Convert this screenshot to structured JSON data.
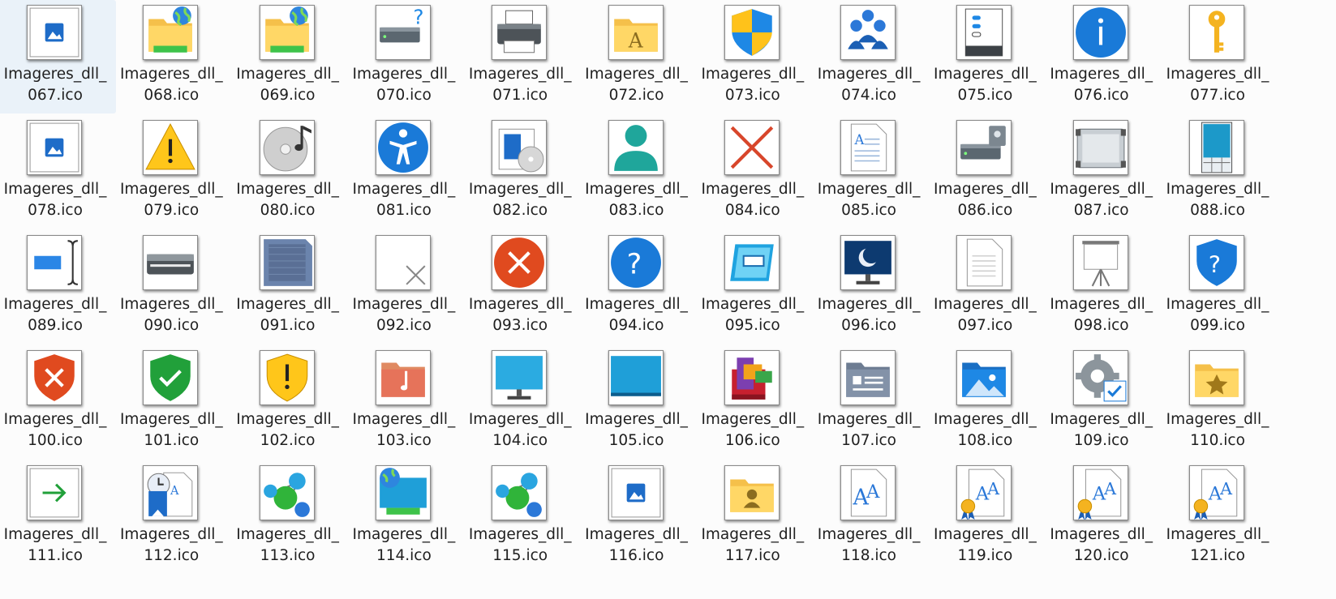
{
  "window": {
    "view": "Large icons"
  },
  "colors": {
    "background": "#fcfcfc",
    "text": "#1f1f1f",
    "thumb_border": "#8a8a8a",
    "accent": "#0078d4"
  },
  "files": [
    {
      "line1": "Imageres_dll_",
      "line2": "067.ico",
      "icon": "picture-frame-icon"
    },
    {
      "line1": "Imageres_dll_",
      "line2": "068.ico",
      "icon": "network-folder-globe-icon"
    },
    {
      "line1": "Imageres_dll_",
      "line2": "069.ico",
      "icon": "network-folder-globe-icon"
    },
    {
      "line1": "Imageres_dll_",
      "line2": "070.ico",
      "icon": "unknown-drive-icon"
    },
    {
      "line1": "Imageres_dll_",
      "line2": "071.ico",
      "icon": "printer-icon"
    },
    {
      "line1": "Imageres_dll_",
      "line2": "072.ico",
      "icon": "fonts-folder-icon"
    },
    {
      "line1": "Imageres_dll_",
      "line2": "073.ico",
      "icon": "uac-shield-icon"
    },
    {
      "line1": "Imageres_dll_",
      "line2": "074.ico",
      "icon": "user-group-icon"
    },
    {
      "line1": "Imageres_dll_",
      "line2": "075.ico",
      "icon": "server-settings-icon"
    },
    {
      "line1": "Imageres_dll_",
      "line2": "076.ico",
      "icon": "info-icon"
    },
    {
      "line1": "Imageres_dll_",
      "line2": "077.ico",
      "icon": "key-icon"
    },
    {
      "line1": "Imageres_dll_",
      "line2": "078.ico",
      "icon": "picture-frame-icon"
    },
    {
      "line1": "Imageres_dll_",
      "line2": "079.ico",
      "icon": "warning-icon"
    },
    {
      "line1": "Imageres_dll_",
      "line2": "080.ico",
      "icon": "music-disc-icon"
    },
    {
      "line1": "Imageres_dll_",
      "line2": "081.ico",
      "icon": "accessibility-icon"
    },
    {
      "line1": "Imageres_dll_",
      "line2": "082.ico",
      "icon": "software-disc-icon"
    },
    {
      "line1": "Imageres_dll_",
      "line2": "083.ico",
      "icon": "user-icon"
    },
    {
      "line1": "Imageres_dll_",
      "line2": "084.ico",
      "icon": "red-x-icon"
    },
    {
      "line1": "Imageres_dll_",
      "line2": "085.ico",
      "icon": "text-document-icon"
    },
    {
      "line1": "Imageres_dll_",
      "line2": "086.ico",
      "icon": "drive-lock-icon"
    },
    {
      "line1": "Imageres_dll_",
      "line2": "087.ico",
      "icon": "hardware-panel-icon"
    },
    {
      "line1": "Imageres_dll_",
      "line2": "088.ico",
      "icon": "phone-device-icon"
    },
    {
      "line1": "Imageres_dll_",
      "line2": "089.ico",
      "icon": "text-cursor-icon"
    },
    {
      "line1": "Imageres_dll_",
      "line2": "090.ico",
      "icon": "scanner-icon"
    },
    {
      "line1": "Imageres_dll_",
      "line2": "091.ico",
      "icon": "memory-card-icon"
    },
    {
      "line1": "Imageres_dll_",
      "line2": "092.ico",
      "icon": "blank-x-icon"
    },
    {
      "line1": "Imageres_dll_",
      "line2": "093.ico",
      "icon": "error-icon"
    },
    {
      "line1": "Imageres_dll_",
      "line2": "094.ico",
      "icon": "help-icon"
    },
    {
      "line1": "Imageres_dll_",
      "line2": "095.ico",
      "icon": "remote-window-icon"
    },
    {
      "line1": "Imageres_dll_",
      "line2": "096.ico",
      "icon": "monitor-sleep-icon"
    },
    {
      "line1": "Imageres_dll_",
      "line2": "097.ico",
      "icon": "blank-document-icon"
    },
    {
      "line1": "Imageres_dll_",
      "line2": "098.ico",
      "icon": "projector-screen-icon"
    },
    {
      "line1": "Imageres_dll_",
      "line2": "099.ico",
      "icon": "help-shield-icon"
    },
    {
      "line1": "Imageres_dll_",
      "line2": "100.ico",
      "icon": "error-shield-icon"
    },
    {
      "line1": "Imageres_dll_",
      "line2": "101.ico",
      "icon": "ok-shield-icon"
    },
    {
      "line1": "Imageres_dll_",
      "line2": "102.ico",
      "icon": "warning-shield-icon"
    },
    {
      "line1": "Imageres_dll_",
      "line2": "103.ico",
      "icon": "music-folder-icon"
    },
    {
      "line1": "Imageres_dll_",
      "line2": "104.ico",
      "icon": "monitor-icon"
    },
    {
      "line1": "Imageres_dll_",
      "line2": "105.ico",
      "icon": "desktop-icon"
    },
    {
      "line1": "Imageres_dll_",
      "line2": "106.ico",
      "icon": "programs-icon"
    },
    {
      "line1": "Imageres_dll_",
      "line2": "107.ico",
      "icon": "contacts-folder-icon"
    },
    {
      "line1": "Imageres_dll_",
      "line2": "108.ico",
      "icon": "pictures-folder-icon"
    },
    {
      "line1": "Imageres_dll_",
      "line2": "109.ico",
      "icon": "gear-check-icon"
    },
    {
      "line1": "Imageres_dll_",
      "line2": "110.ico",
      "icon": "favorites-folder-icon"
    },
    {
      "line1": "Imageres_dll_",
      "line2": "111.ico",
      "icon": "arrow-right-icon"
    },
    {
      "line1": "Imageres_dll_",
      "line2": "112.ico",
      "icon": "recent-document-icon"
    },
    {
      "line1": "Imageres_dll_",
      "line2": "113.ico",
      "icon": "network-nodes-icon"
    },
    {
      "line1": "Imageres_dll_",
      "line2": "114.ico",
      "icon": "network-globe-monitor-icon"
    },
    {
      "line1": "Imageres_dll_",
      "line2": "115.ico",
      "icon": "network-nodes-icon"
    },
    {
      "line1": "Imageres_dll_",
      "line2": "116.ico",
      "icon": "picture-frame-icon"
    },
    {
      "line1": "Imageres_dll_",
      "line2": "117.ico",
      "icon": "user-folder-icon"
    },
    {
      "line1": "Imageres_dll_",
      "line2": "118.ico",
      "icon": "font-file-icon"
    },
    {
      "line1": "Imageres_dll_",
      "line2": "119.ico",
      "icon": "certified-font-icon"
    },
    {
      "line1": "Imageres_dll_",
      "line2": "120.ico",
      "icon": "certified-font-icon"
    },
    {
      "line1": "Imageres_dll_",
      "line2": "121.ico",
      "icon": "certified-font-icon"
    }
  ]
}
